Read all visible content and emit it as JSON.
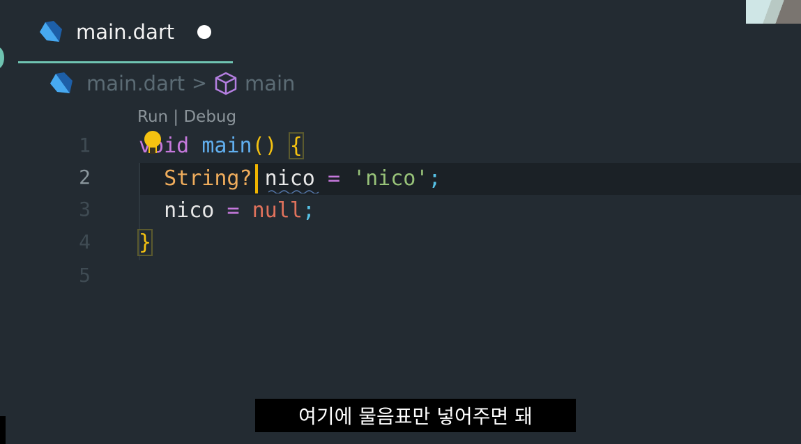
{
  "tab": {
    "filename": "main.dart",
    "icon": "dart-logo-icon",
    "unsaved": true
  },
  "breadcrumb": {
    "file": "main.dart",
    "separator": ">",
    "symbol": "main",
    "symbol_icon": "cube-icon"
  },
  "codelens": "Run | Debug",
  "line_numbers": [
    "1",
    "2",
    "3",
    "4",
    "5"
  ],
  "active_line": 2,
  "code": {
    "line1": {
      "void": "void",
      "name": "main",
      "parens": "()",
      "brace": "{"
    },
    "line2": {
      "type": "String?",
      "ident": "nico",
      "eq": "=",
      "str": "'nico'",
      "semi": ";"
    },
    "line3": {
      "ident": "nico",
      "eq": "=",
      "null": "null",
      "semi": ";"
    },
    "line4": {
      "brace": "}"
    }
  },
  "subtitle": "여기에 물음표만 넣어주면 돼",
  "colors": {
    "background": "#232b32",
    "accent": "#6fc3b1",
    "cursor": "#f0b400"
  }
}
